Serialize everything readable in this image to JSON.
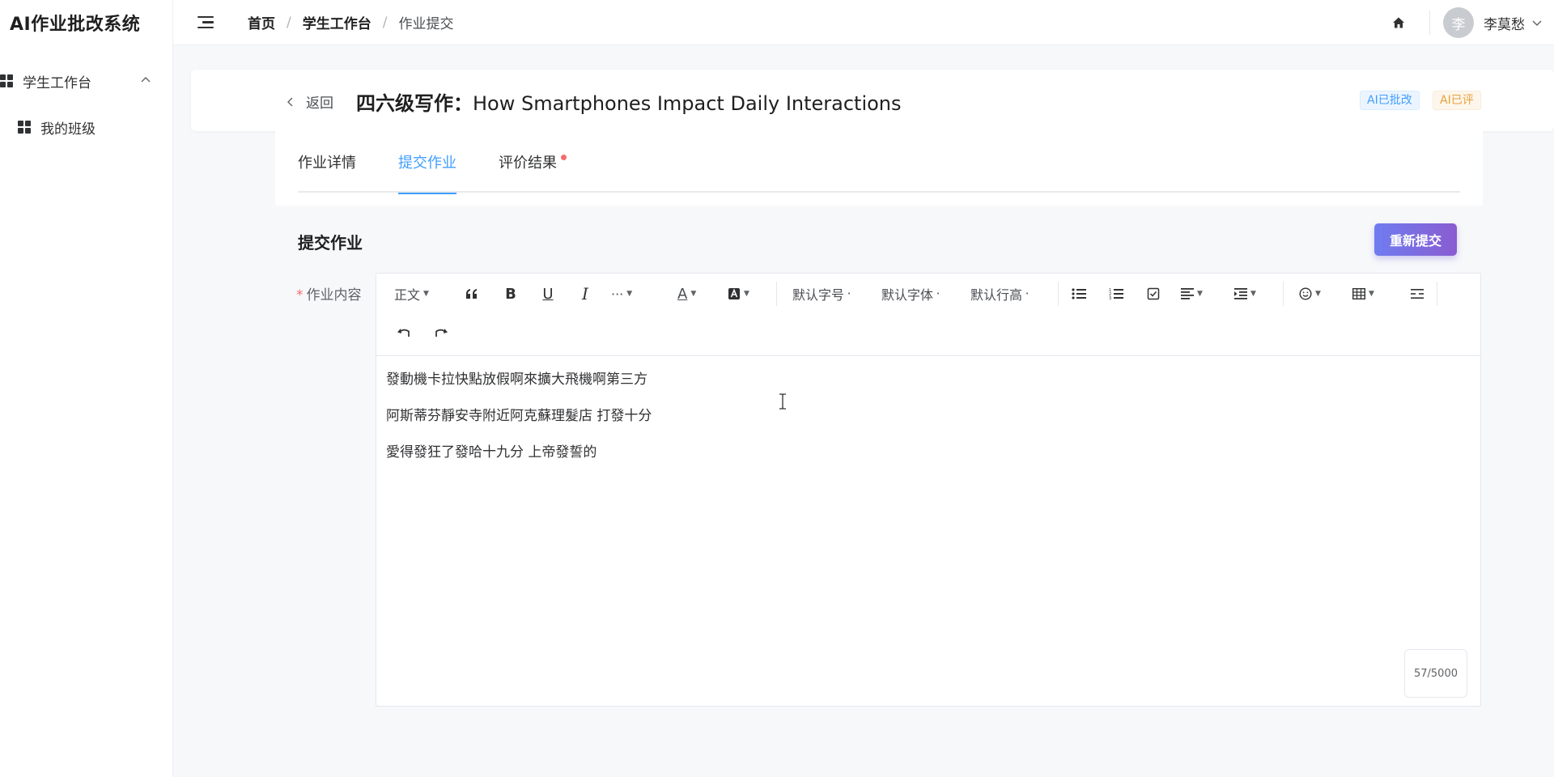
{
  "app": {
    "title": "AI作业批改系统"
  },
  "sidebar": {
    "group_label": "学生工作台",
    "items": [
      {
        "label": "我的班级"
      }
    ]
  },
  "breadcrumb": {
    "home": "首页",
    "workspace": "学生工作台",
    "current": "作业提交"
  },
  "user": {
    "avatar_text": "李",
    "name": "李莫愁"
  },
  "header": {
    "back_label": "返回",
    "title_prefix": "四六级写作：",
    "title_rest": "How Smartphones Impact Daily Interactions",
    "badges": [
      "AI已批改",
      "AI已评"
    ]
  },
  "tabs": [
    {
      "label": "作业详情"
    },
    {
      "label": "提交作业",
      "active": true
    },
    {
      "label": "评价结果",
      "has_dot": true
    }
  ],
  "submit": {
    "section_title": "提交作业",
    "resubmit_label": "重新提交",
    "field_label": "作业内容",
    "toolbar": {
      "paragraph": "正文",
      "font_size": "默认字号",
      "font_family": "默认字体",
      "line_height": "默认行高",
      "more": "···"
    },
    "content": [
      "發動機卡拉快點放假啊來擴大飛機啊第三方",
      "阿斯蒂芬靜安寺附近阿克蘇理髮店 打發十分",
      "愛得發狂了發哈十九分 上帝發誓的"
    ],
    "counter": "57/5000"
  },
  "colors": {
    "accent": "#409eff",
    "badge_blue": "#409eff",
    "badge_orange": "#e6a23c",
    "button_gradient_start": "#6f7cf0",
    "button_gradient_end": "#8a5cd1",
    "notice_dot": "#f56c6c"
  }
}
